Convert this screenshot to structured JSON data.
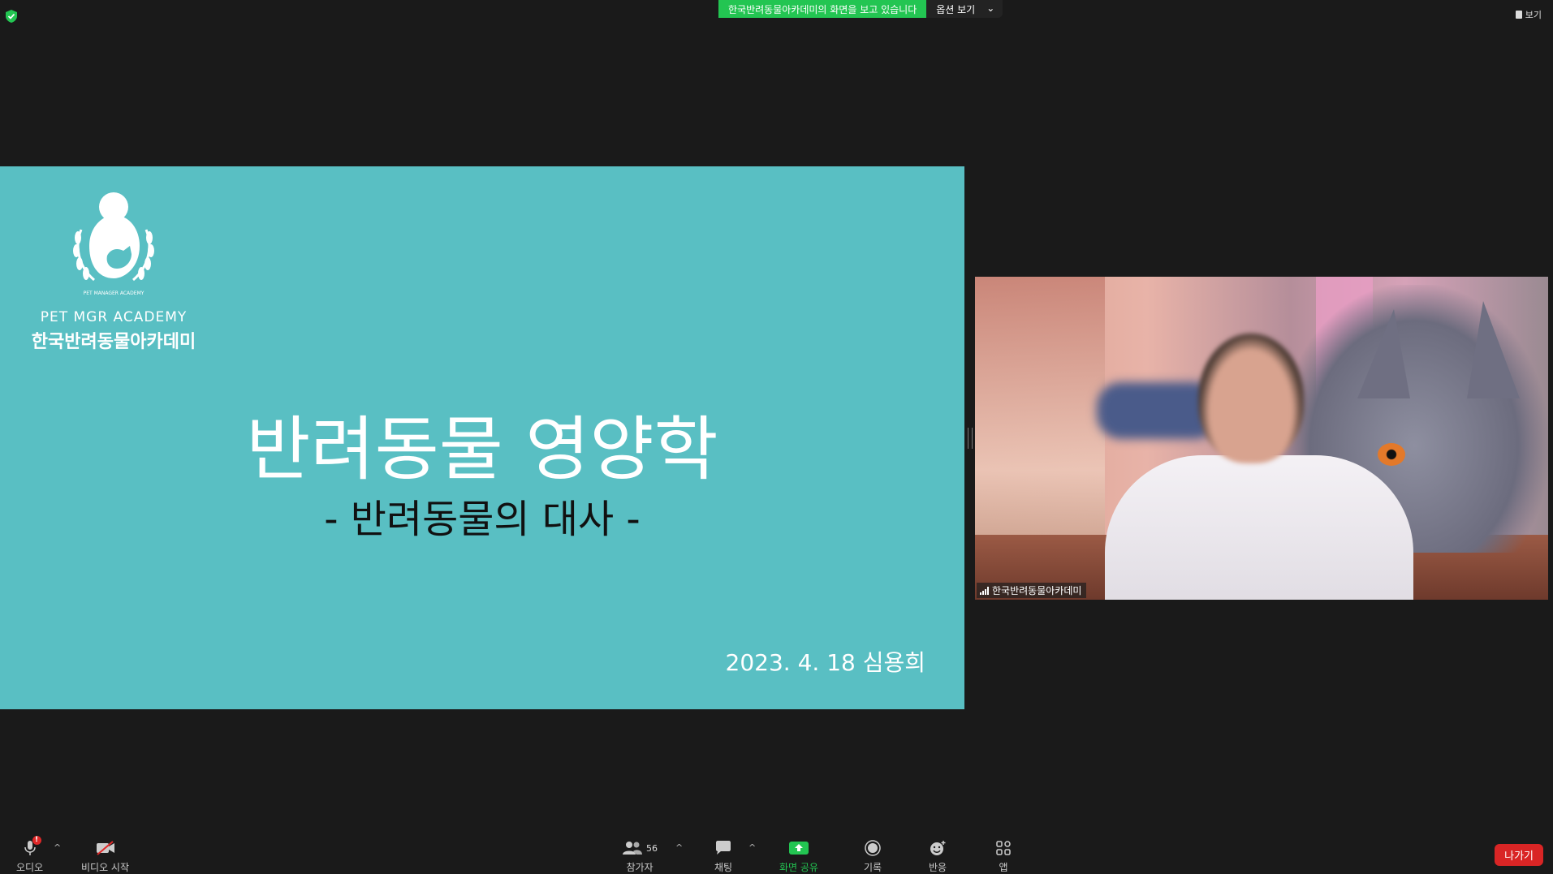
{
  "top_banner": {
    "viewing_text": "한국반려동물아카데미의 화면을 보고 있습니다",
    "options_label": "옵션 보기",
    "view_label": "보기"
  },
  "slide": {
    "logo_en": "PET MGR ACADEMY",
    "logo_ko": "한국반려동물아카데미",
    "logo_ring_text": "PET MANAGER ACADEMY",
    "title": "반려동물 영양학",
    "subtitle": "- 반려동물의 대사 -",
    "date_author": "2023. 4. 18  심용희",
    "background_color": "#59bfc3"
  },
  "video_tile": {
    "participant_name": "한국반려동물아카데미"
  },
  "toolbar": {
    "audio_label": "오디오",
    "audio_badge": "!",
    "video_label": "비디오 시작",
    "participants_label": "참가자",
    "participants_count": "56",
    "chat_label": "채팅",
    "share_label": "화면 공유",
    "record_label": "기록",
    "reactions_label": "반응",
    "apps_label": "앱",
    "leave_label": "나가기"
  },
  "colors": {
    "share_green": "#23c552",
    "leave_red": "#d92525",
    "background": "#1a1a1a"
  }
}
